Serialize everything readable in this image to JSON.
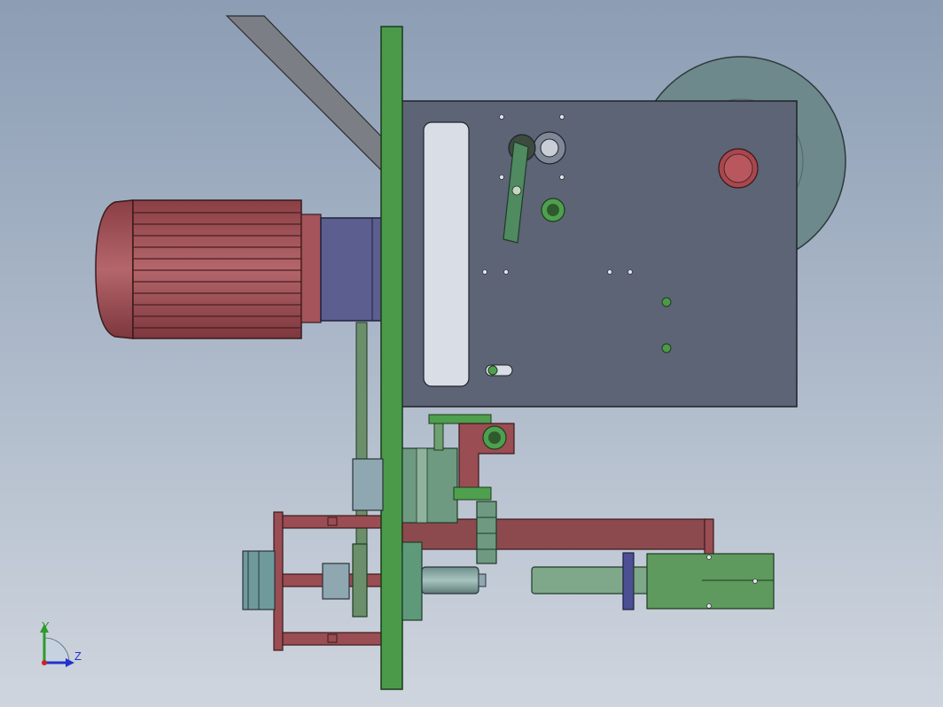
{
  "triad": {
    "y_label": "Y",
    "z_label": "Z",
    "y_color": "#2f9a2f",
    "z_color": "#2233cc",
    "origin_color": "#cc2222"
  },
  "colors": {
    "background_top": "#8c9db4",
    "background_bottom": "#cfd5de",
    "plate": "#4a9a4a",
    "housing": "#5e6677",
    "motor": "#9e4f55",
    "wheel": "#6f8a8c",
    "gearbox": "#595b8c",
    "bracket": "#8c4a4f"
  }
}
